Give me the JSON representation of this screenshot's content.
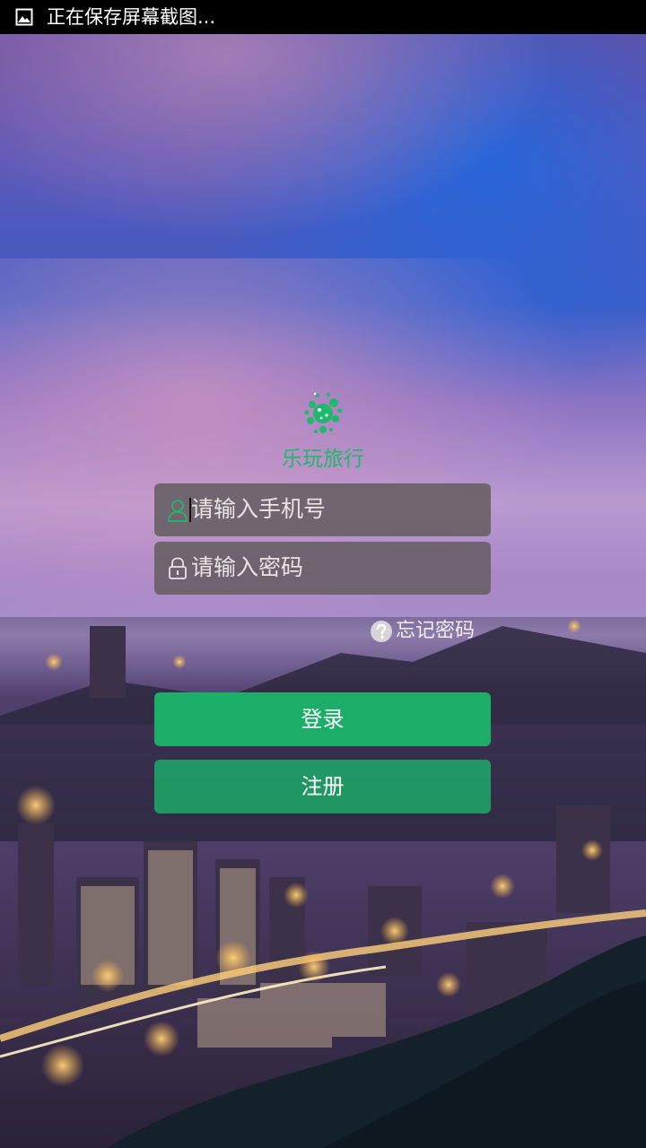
{
  "status_bar": {
    "text": "正在保存屏幕截图...",
    "icon": "image-icon"
  },
  "app": {
    "name": "乐玩旅行",
    "brand_color": "#1fb86c"
  },
  "login_form": {
    "phone_placeholder": "请输入手机号",
    "password_placeholder": "请输入密码",
    "forgot_label": "忘记密码",
    "login_label": "登录",
    "register_label": "注册"
  }
}
